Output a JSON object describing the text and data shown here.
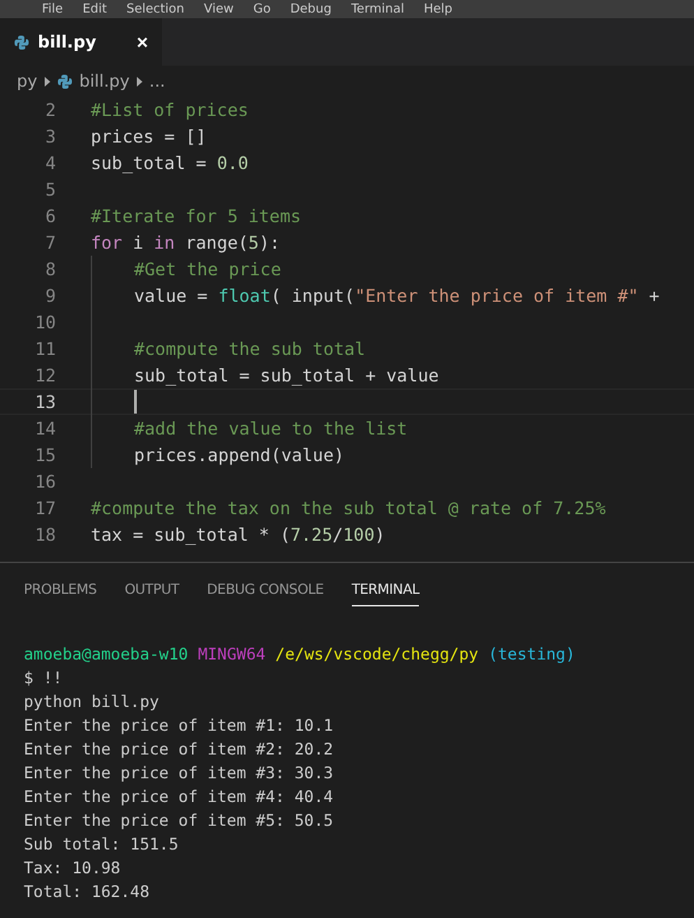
{
  "menu_bar": {
    "items": [
      "File",
      "Edit",
      "Selection",
      "View",
      "Go",
      "Debug",
      "Terminal",
      "Help"
    ]
  },
  "editor_tabs": [
    {
      "label": "bill.py",
      "close": "×",
      "selected": true
    }
  ],
  "breadcrumb": {
    "folder": "py",
    "file": "bill.py",
    "more": "..."
  },
  "code_lines": [
    {
      "number": "2",
      "in_block": false,
      "current": false,
      "tokens": [
        {
          "kind": "comment",
          "text": "#List of prices"
        }
      ]
    },
    {
      "number": "3",
      "in_block": false,
      "current": false,
      "tokens": [
        {
          "kind": "plain",
          "text": "prices = []"
        }
      ]
    },
    {
      "number": "4",
      "in_block": false,
      "current": false,
      "tokens": [
        {
          "kind": "plain",
          "text": "sub_total = "
        },
        {
          "kind": "number",
          "text": "0.0"
        }
      ]
    },
    {
      "number": "5",
      "in_block": false,
      "current": false
    },
    {
      "number": "6",
      "in_block": false,
      "current": false,
      "tokens": [
        {
          "kind": "comment",
          "text": "#Iterate for 5 items"
        }
      ]
    },
    {
      "number": "7",
      "in_block": false,
      "current": false,
      "tokens": [
        {
          "kind": "keyword",
          "text": "for"
        },
        {
          "kind": "plain",
          "text": " i "
        },
        {
          "kind": "keyword",
          "text": "in"
        },
        {
          "kind": "plain",
          "text": " range("
        },
        {
          "kind": "number",
          "text": "5"
        },
        {
          "kind": "plain",
          "text": "):"
        }
      ]
    },
    {
      "number": "8",
      "in_block": true,
      "current": false,
      "tokens": [
        {
          "kind": "comment",
          "text": "#Get the price"
        }
      ]
    },
    {
      "number": "9",
      "in_block": true,
      "current": false,
      "tokens": [
        {
          "kind": "plain",
          "text": "value = "
        },
        {
          "kind": "builtin",
          "text": "float"
        },
        {
          "kind": "plain",
          "text": "( input("
        },
        {
          "kind": "string",
          "text": "\"Enter the price of item #\""
        },
        {
          "kind": "plain",
          "text": " +"
        }
      ]
    },
    {
      "number": "10",
      "in_block": true,
      "current": false
    },
    {
      "number": "11",
      "in_block": true,
      "current": false,
      "tokens": [
        {
          "kind": "comment",
          "text": "#compute the sub total"
        }
      ]
    },
    {
      "number": "12",
      "in_block": true,
      "current": false,
      "tokens": [
        {
          "kind": "plain",
          "text": "sub_total = sub_total + value"
        }
      ]
    },
    {
      "number": "13",
      "in_block": true,
      "current": true
    },
    {
      "number": "14",
      "in_block": true,
      "current": false,
      "tokens": [
        {
          "kind": "comment",
          "text": "#add the value to the list"
        }
      ]
    },
    {
      "number": "15",
      "in_block": true,
      "current": false,
      "tokens": [
        {
          "kind": "plain",
          "text": "prices.append(value)"
        }
      ]
    },
    {
      "number": "16",
      "in_block": false,
      "current": false
    },
    {
      "number": "17",
      "in_block": false,
      "current": false,
      "tokens": [
        {
          "kind": "comment",
          "text": "#compute the tax on the sub total @ rate of 7.25%"
        }
      ]
    },
    {
      "number": "18",
      "in_block": false,
      "current": false,
      "tokens": [
        {
          "kind": "plain",
          "text": "tax = sub_total * ("
        },
        {
          "kind": "number",
          "text": "7.25"
        },
        {
          "kind": "plain",
          "text": "/"
        },
        {
          "kind": "number",
          "text": "100"
        },
        {
          "kind": "plain",
          "text": ")"
        }
      ]
    }
  ],
  "panel_tabs": [
    {
      "label": "PROBLEMS",
      "selected": false
    },
    {
      "label": "OUTPUT",
      "selected": false
    },
    {
      "label": "DEBUG CONSOLE",
      "selected": false
    },
    {
      "label": "TERMINAL",
      "selected": true
    }
  ],
  "terminal": {
    "prompt": [
      {
        "kind": "user",
        "text": "amoeba@amoeba-w10"
      },
      {
        "kind": "system",
        "text": "MINGW64"
      },
      {
        "kind": "path",
        "text": "/e/ws/vscode/chegg/py"
      },
      {
        "kind": "branch",
        "text": "(testing)"
      }
    ],
    "lines": [
      "$ !!",
      "python bill.py",
      "Enter the price of item #1: 10.1",
      "Enter the price of item #2: 20.2",
      "Enter the price of item #3: 30.3",
      "Enter the price of item #4: 40.4",
      "Enter the price of item #5: 50.5",
      "Sub total: 151.5",
      "Tax: 10.98",
      "Total: 162.48"
    ]
  }
}
